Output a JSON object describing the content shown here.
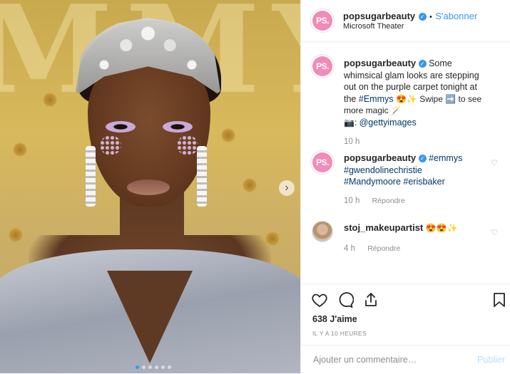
{
  "post": {
    "image_alt_watermark": "MMY",
    "carousel": {
      "slide_count": 6,
      "current_slide": 1
    }
  },
  "header": {
    "username": "popsugarbeauty",
    "avatar_text": "PS.",
    "follow_separator": "•",
    "follow_label": "S'abonner",
    "location": "Microsoft Theater"
  },
  "caption": {
    "username": "popsugarbeauty",
    "avatar_text": "PS.",
    "text_1": "Some whimsical glam looks are stepping out on the purple carpet tonight at the",
    "hashtag": "#Emmys",
    "text_2": "😍✨ Swipe ➡️ to see more magic 🪄",
    "credit_prefix": "📷: ",
    "credit_handle": "@gettyimages",
    "time": "10 h"
  },
  "comments": [
    {
      "username": "popsugarbeauty",
      "avatar_text": "PS.",
      "tags_line_1": "#emmys",
      "tags_line_2": "#gwendolinechristie",
      "tags_line_3": "#Mandymoore #erisbaker",
      "time": "10 h",
      "reply_label": "Répondre"
    },
    {
      "username": "stoj_makeupartist",
      "text": "😍😍✨",
      "time": "4 h",
      "reply_label": "Répondre"
    }
  ],
  "actions": {
    "likes": "638 J'aime",
    "time_ago": "IL Y A 10 HEURES"
  },
  "add_comment": {
    "placeholder": "Ajouter un commentaire…",
    "publish_label": "Publier"
  },
  "colors": {
    "link_blue": "#3897f0",
    "hashtag_blue": "#00376b",
    "muted_gray": "#8e8e8e",
    "publish_disabled": "#b2dffc",
    "ps_pink": "#f18bb7"
  }
}
